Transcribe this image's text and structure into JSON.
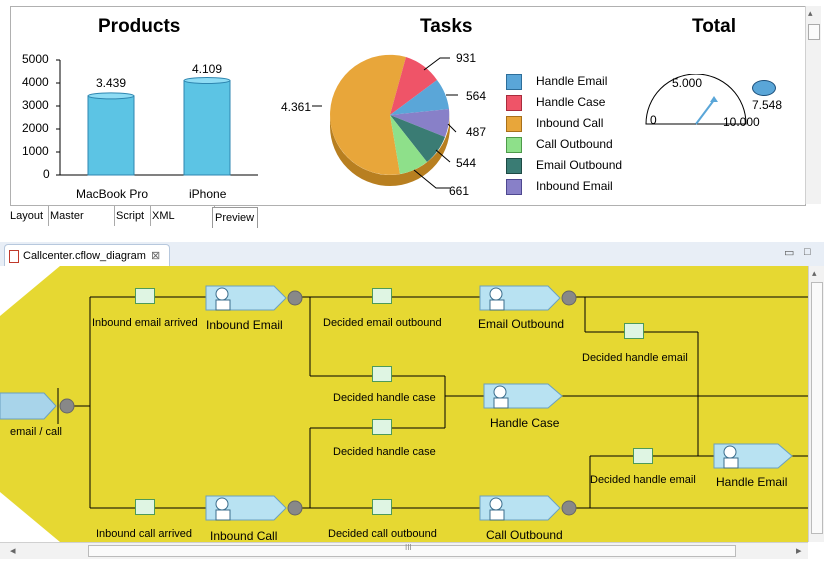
{
  "products": {
    "title": "Products",
    "y_ticks": [
      "5000",
      "4000",
      "3000",
      "2000",
      "1000",
      "0"
    ],
    "bars": [
      {
        "label": "MacBook Pro",
        "value_label": "3.439",
        "value": 3439
      },
      {
        "label": "iPhone",
        "value_label": "4.109",
        "value": 4109
      }
    ]
  },
  "tasks": {
    "title": "Tasks",
    "slice_labels": {
      "inbound_call": "4.361",
      "handle_case": "931",
      "handle_email": "564",
      "inbound_email": "487",
      "email_outbound": "544",
      "call_outbound": "661"
    },
    "legend": [
      {
        "label": "Handle Email",
        "color": "#5aa6d8"
      },
      {
        "label": "Handle Case",
        "color": "#ef5468"
      },
      {
        "label": "Inbound Call",
        "color": "#e8a63a"
      },
      {
        "label": "Call Outbound",
        "color": "#8ee08a"
      },
      {
        "label": "Email Outbound",
        "color": "#3a7c74"
      },
      {
        "label": "Inbound Email",
        "color": "#8880c8"
      }
    ]
  },
  "total": {
    "title": "Total",
    "gauge_top": "5.000",
    "gauge_min": "0",
    "gauge_max": "10.000",
    "value": "7.548"
  },
  "editor_tabs": [
    {
      "label": "Layout"
    },
    {
      "label": "Master Page"
    },
    {
      "label": "Script"
    },
    {
      "label": "XML Source"
    },
    {
      "label": "Preview"
    }
  ],
  "editor": {
    "file_tab": "Callcenter.cflow_diagram",
    "close_glyph": "⊠",
    "hscroll_grip": "III",
    "scroll_left": "◂",
    "scroll_right": "▸",
    "scroll_up": "▴",
    "scroll_down": "▾"
  },
  "diagram": {
    "start_label": "email / call",
    "decisions": {
      "inbound_email_arrived": "Inbound email arrived",
      "decided_email_outbound": "Decided email outbound",
      "decided_handle_email_top": "Decided handle email",
      "decided_handle_case_1": "Decided handle case",
      "decided_handle_case_2": "Decided handle case",
      "decided_handle_email_bottom": "Decided handle email",
      "inbound_call_arrived": "Inbound call arrived",
      "decided_call_outbound": "Decided call outbound"
    },
    "tasks": {
      "inbound_email": "Inbound Email",
      "email_outbound": "Email Outbound",
      "handle_case": "Handle Case",
      "handle_email": "Handle Email",
      "inbound_call": "Inbound Call",
      "call_outbound": "Call Outbound"
    }
  }
}
